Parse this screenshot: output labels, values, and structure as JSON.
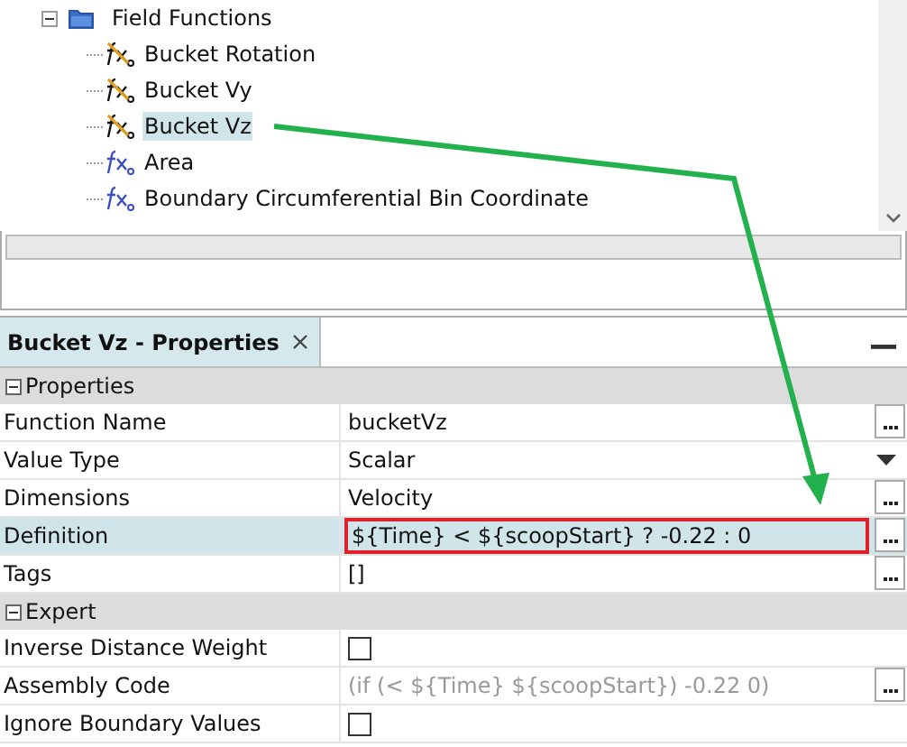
{
  "tree": {
    "folder": {
      "label": "Field Functions",
      "expanded": true
    },
    "items": [
      {
        "label": "Bucket Rotation",
        "kind": "user",
        "selected": false
      },
      {
        "label": "Bucket Vy",
        "kind": "user",
        "selected": false
      },
      {
        "label": "Bucket Vz",
        "kind": "user",
        "selected": true
      },
      {
        "label": "Area",
        "kind": "system",
        "selected": false
      },
      {
        "label": "Boundary Circumferential Bin Coordinate",
        "kind": "system",
        "selected": false
      }
    ]
  },
  "panel": {
    "title": "Bucket Vz - Properties",
    "groups": [
      {
        "label": "Properties",
        "expanded": true,
        "rows": [
          {
            "label": "Function Name",
            "value": "bucketVz",
            "kind": "text",
            "button": true,
            "selected": false,
            "highlighted": false,
            "disabled": false
          },
          {
            "label": "Value Type",
            "value": "Scalar",
            "kind": "dropdown",
            "button": false,
            "selected": false,
            "highlighted": false,
            "disabled": false
          },
          {
            "label": "Dimensions",
            "value": "Velocity",
            "kind": "text",
            "button": true,
            "selected": false,
            "highlighted": false,
            "disabled": false
          },
          {
            "label": "Definition",
            "value": "${Time} < ${scoopStart} ? -0.22 : 0",
            "kind": "text",
            "button": true,
            "selected": true,
            "highlighted": true,
            "disabled": false
          },
          {
            "label": "Tags",
            "value": "[]",
            "kind": "text",
            "button": true,
            "selected": false,
            "highlighted": false,
            "disabled": false
          }
        ]
      },
      {
        "label": "Expert",
        "expanded": true,
        "rows": [
          {
            "label": "Inverse Distance Weight",
            "kind": "checkbox",
            "checked": false,
            "selected": false
          },
          {
            "label": "Assembly Code",
            "value": "(if (< ${Time} ${scoopStart}) -0.22 0)",
            "kind": "text",
            "button": true,
            "selected": false,
            "highlighted": false,
            "disabled": true
          },
          {
            "label": "Ignore Boundary Values",
            "kind": "checkbox",
            "checked": false,
            "selected": false
          }
        ]
      }
    ]
  }
}
